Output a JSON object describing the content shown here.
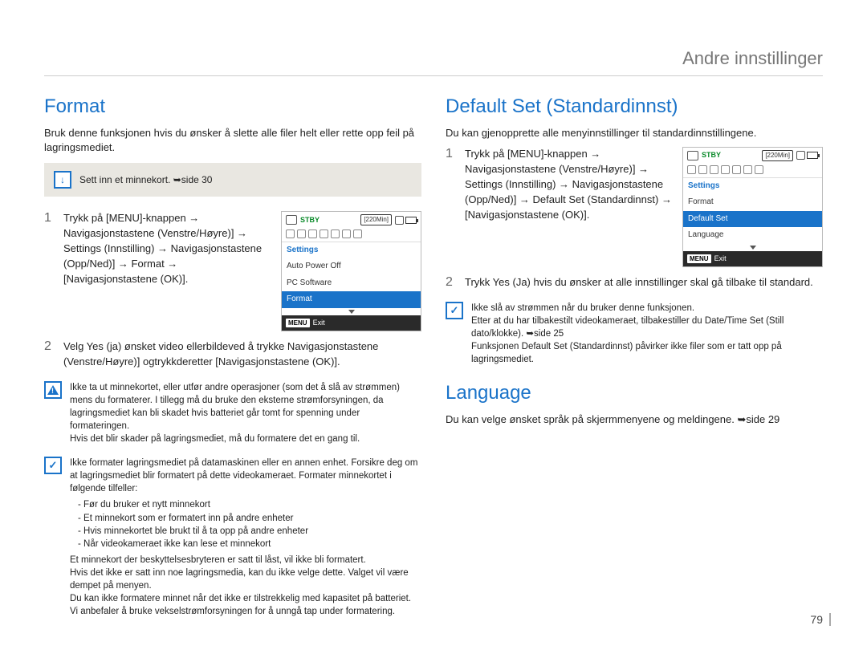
{
  "header": {
    "title": "Andre innstillinger"
  },
  "page_number": "79",
  "left": {
    "title": "Format",
    "intro": "Bruk denne funksjonen hvis du ønsker å slette alle filer helt eller rette opp feil på lagringsmediet.",
    "callout": "Sett inn et minnekort. ➥side 30",
    "step1": "Trykk på [MENU]-knappen → Navigasjonstastene (Venstre/Høyre)] → Settings (Innstilling) → Navigasjonstastene (Opp/Ned)] → Format → [Navigasjonstastene (OK)].",
    "step2": "Velg Yes (ja) ønsket video ellerbildeved å trykke Navigasjonstastene (Venstre/Høyre)] ogtrykkderetter [Navigasjonstastene (OK)].",
    "lcd": {
      "status": "STBY",
      "time": "[220Min]",
      "settings": "Settings",
      "items": [
        "Auto Power Off",
        "PC Software",
        "Format"
      ],
      "selected_index": 2,
      "exit": "Exit",
      "menu_tag": "MENU"
    },
    "warnnote": "Ikke ta ut minnekortet, eller utfør andre operasjoner (som det å slå av strømmen) mens du formaterer. I tillegg må du bruke den eksterne strømforsyningen, da lagringsmediet kan bli skadet hvis batteriet går tomt for spenning under formateringen.\nHvis det blir skader på lagringsmediet, må du formatere det en gang til.",
    "infonote_lead": "Ikke formater lagringsmediet på datamaskinen eller en annen enhet. Forsikre deg om at lagringsmediet blir formatert på dette videokameraet. Formater minnekortet i følgende tilfeller:",
    "infonote_list": [
      "-   Før du bruker et nytt minnekort",
      "-   Et minnekort som er formatert inn på andre enheter",
      "-   Hvis minnekortet ble brukt til å ta opp på andre enheter",
      "-   Når videokameraet ikke kan lese et minnekort"
    ],
    "infonote_tail": "Et minnekort der beskyttelsesbryteren er satt til låst, vil ikke bli formatert.\nHvis det ikke er satt inn noe lagringsmedia, kan du ikke velge dette. Valget vil være dempet på menyen.\nDu kan ikke formatere minnet når det ikke er tilstrekkelig med kapasitet på batteriet. Vi anbefaler å bruke vekselstrømforsyningen for å unngå tap under formatering."
  },
  "right": {
    "default_title": "Default Set (Standardinnst)",
    "default_intro": "Du kan gjenopprette alle menyinnstillinger til standardinnstillingene.",
    "default_step1": "Trykk på [MENU]-knappen → Navigasjonstastene (Venstre/Høyre)] → Settings (Innstilling) → Navigasjonstastene (Opp/Ned)] → Default Set (Standardinnst) → [Navigasjonstastene (OK)].",
    "default_step2": "Trykk Yes (Ja) hvis du ønsker at alle innstillinger skal gå tilbake til standard.",
    "lcd": {
      "status": "STBY",
      "time": "[220Min]",
      "settings": "Settings",
      "items": [
        "Format",
        "Default Set",
        "Language"
      ],
      "selected_index": 1,
      "exit": "Exit",
      "menu_tag": "MENU"
    },
    "default_note": "Ikke slå av strømmen når du bruker denne funksjonen.\nEtter at du har tilbakestilt videokameraet, tilbakestiller du Date/Time Set (Still dato/klokke). ➥side 25\nFunksjonen Default Set (Standardinnst) påvirker ikke filer som er tatt opp på lagringsmediet.",
    "lang_title": "Language",
    "lang_body": "Du kan velge ønsket språk på skjermmenyene og meldingene. ➥side 29"
  }
}
